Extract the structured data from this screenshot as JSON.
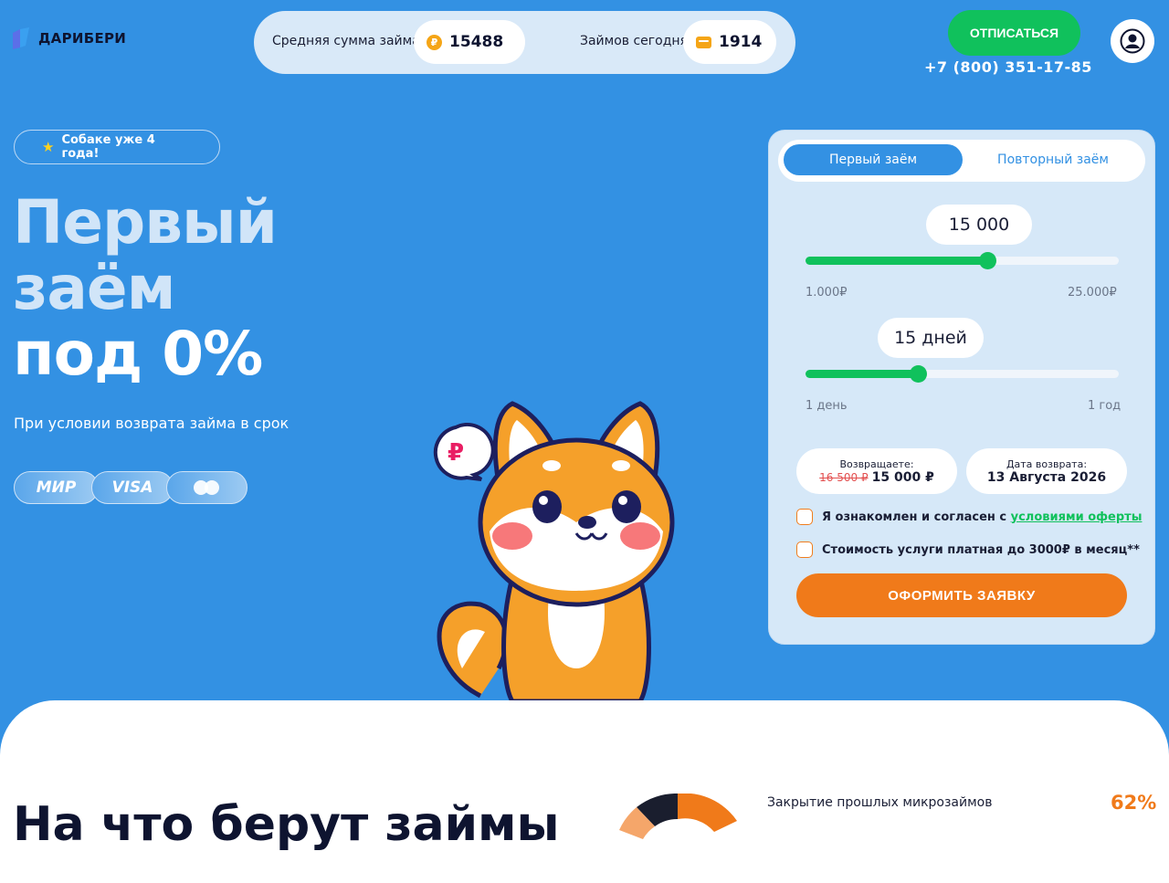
{
  "brand": {
    "name": "ДАРИБЕРИ"
  },
  "stats": {
    "avg_label": "Средняя сумма займа",
    "avg_value": "15488",
    "today_label": "Займов сегодня",
    "today_value": "1914",
    "currency_symbol": "₽"
  },
  "header": {
    "unsubscribe_label": "ОТПИСАТЬСЯ",
    "phone": "+7 (800) 351-17-85"
  },
  "hero": {
    "badge": "Собаке уже 4 года!",
    "title_line1": "Первый",
    "title_line2": "заём",
    "title_line3": "под 0%",
    "subtitle": "При условии возврата займа в срок",
    "payments": [
      "МИР",
      "VISA",
      "mastercard"
    ]
  },
  "calculator": {
    "tabs": [
      "Первый заём",
      "Повторный заём"
    ],
    "active_tab": 0,
    "amount_display": "15 000",
    "amount_min_label": "1.000₽",
    "amount_max_label": "25.000₽",
    "amount_slider_fraction": 0.58,
    "term_display": "15 дней",
    "term_min_label": "1 день",
    "term_max_label": "1 год",
    "term_slider_fraction": 0.36,
    "repay_caption": "Возвращаете:",
    "repay_old": "16 500 ₽",
    "repay_new": "15 000 ₽",
    "date_caption": "Дата возврата:",
    "date_value": "13 Августа 2026",
    "agree_text": "Я ознакомлен и согласен с ",
    "agree_link": "условиями оферты",
    "fee_text": "Стоимость услуги платная до 3000₽ в месяц**",
    "submit_label": "ОФОРМИТЬ ЗАЯВКУ"
  },
  "bottom": {
    "title": "На что берут займы",
    "stat_label": "Закрытие прошлых микрозаймов",
    "stat_value": "62%"
  },
  "colors": {
    "background": "#3391e3",
    "accent_green": "#10c15c",
    "accent_orange": "#f07a1a"
  }
}
